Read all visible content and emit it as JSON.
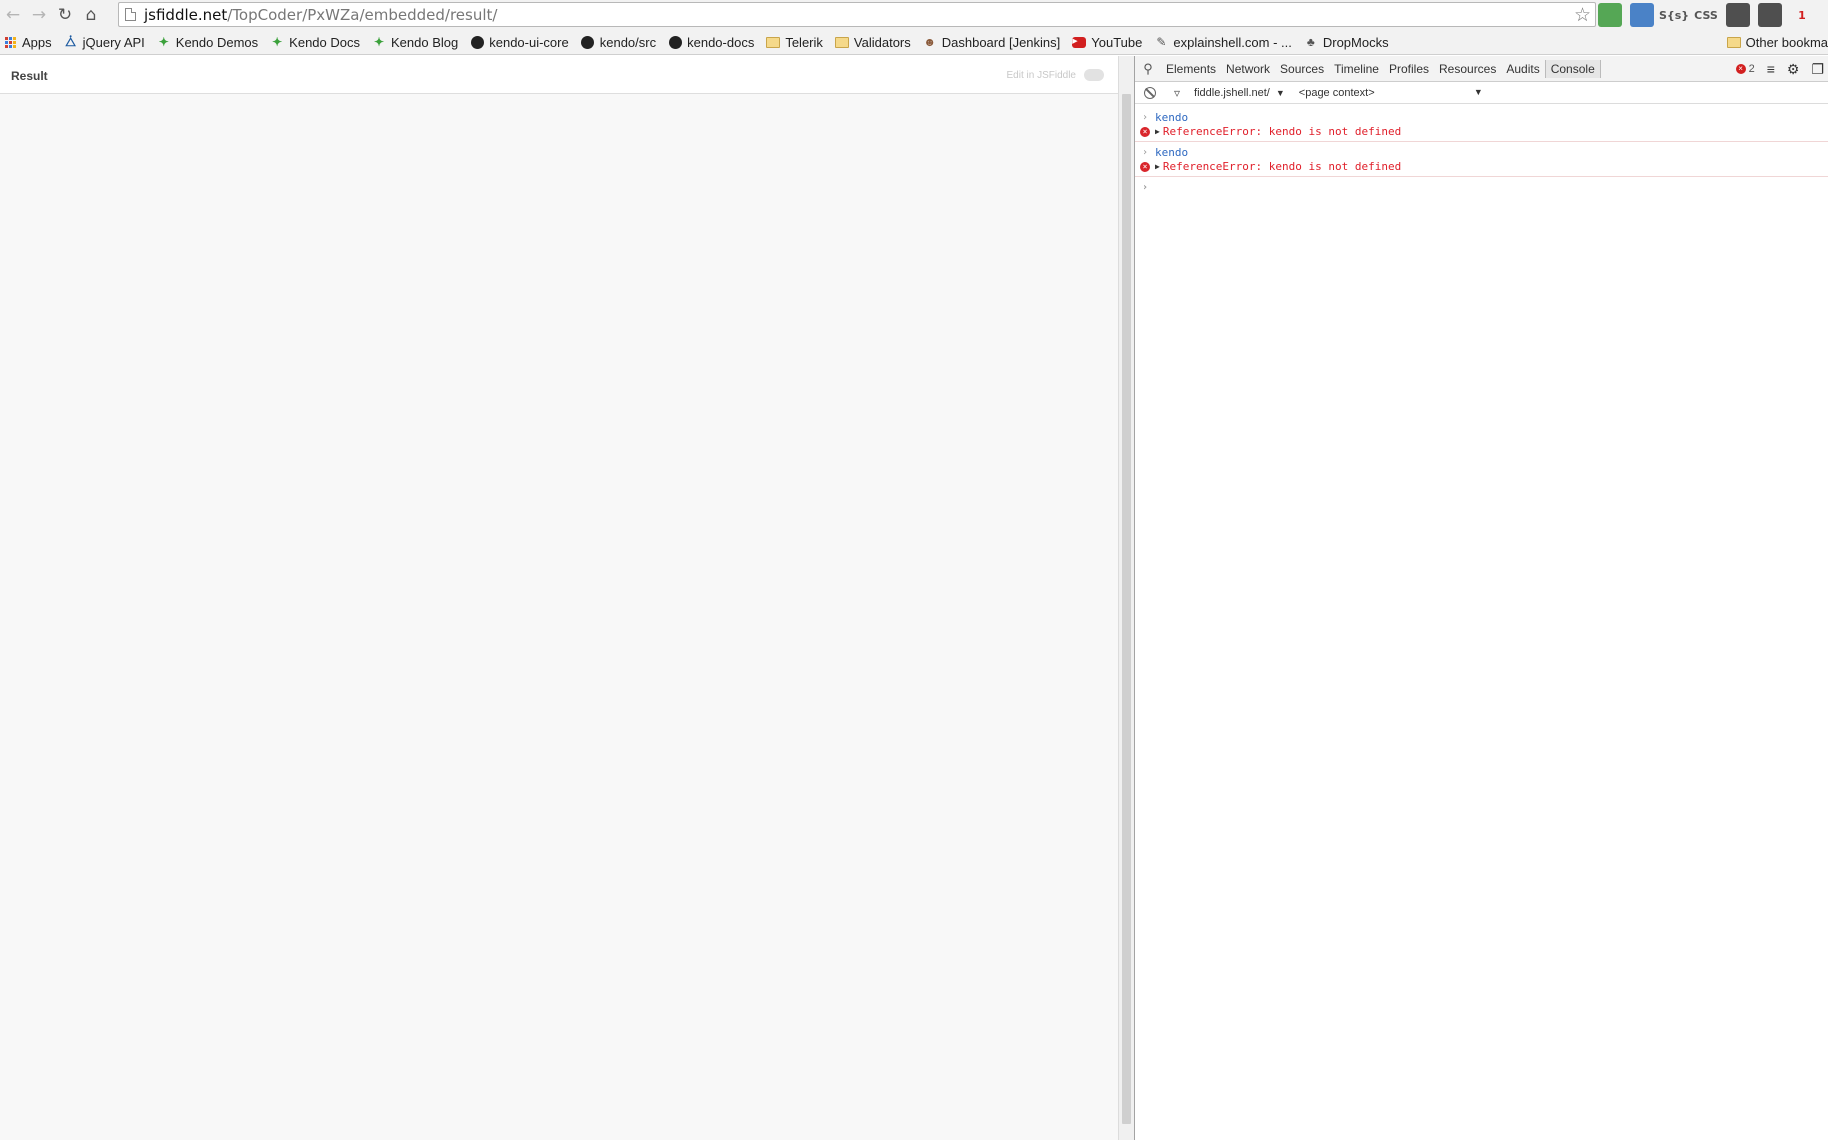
{
  "browser": {
    "url_host": "jsfiddle.net",
    "url_path": "/TopCoder/PxWZa/embedded/result/"
  },
  "extensions": [
    {
      "icon": "refresh-ext-icon",
      "label": "",
      "color": "#3a9a3a"
    },
    {
      "icon": "globe-ext-icon",
      "label": "",
      "color": "#2d6fc0"
    },
    {
      "icon": "sass-ext-icon",
      "label": "S{s}",
      "color": "#555555"
    },
    {
      "icon": "css-ext-icon",
      "label": "CSS",
      "color": "#555555"
    },
    {
      "icon": "qr-ext-icon",
      "label": "",
      "color": "#333333"
    },
    {
      "icon": "eyedropper-ext-icon",
      "label": "",
      "color": "#333333"
    },
    {
      "icon": "notification-ext-icon",
      "label": "1",
      "color": "#d21f1f"
    }
  ],
  "bookmarks": [
    {
      "label": "Apps",
      "icon": "apps-icon"
    },
    {
      "label": "jQuery API",
      "icon": "jquery-icon"
    },
    {
      "label": "Kendo Demos",
      "icon": "kendo-icon"
    },
    {
      "label": "Kendo Docs",
      "icon": "kendo-icon"
    },
    {
      "label": "Kendo Blog",
      "icon": "kendo-icon"
    },
    {
      "label": "kendo-ui-core",
      "icon": "github-icon"
    },
    {
      "label": "kendo/src",
      "icon": "github-icon"
    },
    {
      "label": "kendo-docs",
      "icon": "github-icon"
    },
    {
      "label": "Telerik",
      "icon": "folder-icon"
    },
    {
      "label": "Validators",
      "icon": "folder-icon"
    },
    {
      "label": "Dashboard [Jenkins]",
      "icon": "jenkins-icon"
    },
    {
      "label": "YouTube",
      "icon": "youtube-icon"
    },
    {
      "label": "explainshell.com - ...",
      "icon": "explainshell-icon"
    },
    {
      "label": "DropMocks",
      "icon": "dropmocks-icon"
    }
  ],
  "other_bookmarks": "Other bookma",
  "result": {
    "title": "Result",
    "edit_link": "Edit in JSFiddle"
  },
  "devtools": {
    "tabs": [
      "Elements",
      "Network",
      "Sources",
      "Timeline",
      "Profiles",
      "Resources",
      "Audits",
      "Console"
    ],
    "active_tab": "Console",
    "error_count": "2",
    "frame": "fiddle.jshell.net/",
    "context": "<page context>",
    "console_lines": [
      {
        "type": "input",
        "text": "kendo"
      },
      {
        "type": "error",
        "text": "ReferenceError: kendo is not defined"
      },
      {
        "type": "input",
        "text": "kendo"
      },
      {
        "type": "error",
        "text": "ReferenceError: kendo is not defined"
      }
    ]
  }
}
